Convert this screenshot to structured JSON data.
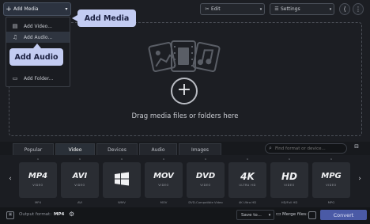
{
  "toolbar": {
    "add_media_label": "Add Media",
    "edit_label": "Edit",
    "settings_label": "Settings"
  },
  "add_menu": {
    "items": [
      {
        "label": "Add Video...",
        "icon": "film-icon"
      },
      {
        "label": "Add Audio...",
        "icon": "music-icon"
      },
      {
        "label": "",
        "icon": ""
      },
      {
        "label": "",
        "icon": ""
      },
      {
        "label": "Add Folder...",
        "icon": "folder-icon"
      }
    ]
  },
  "callouts": {
    "media": "Add Media",
    "audio": "Add Audio"
  },
  "dropzone": {
    "text": "Drag media files or folders here"
  },
  "tabs": [
    "Popular",
    "Video",
    "Devices",
    "Audio",
    "Images"
  ],
  "active_tab": "Video",
  "format_search": {
    "placeholder": "Find format or device..."
  },
  "formats": [
    {
      "logo": "MP4",
      "sub": "VIDEO",
      "label": "MP4"
    },
    {
      "logo": "AVI",
      "sub": "VIDEO",
      "label": "AVI"
    },
    {
      "logo": "",
      "sub": "",
      "label": "WMV"
    },
    {
      "logo": "MOV",
      "sub": "VIDEO",
      "label": "MOV"
    },
    {
      "logo": "DVD",
      "sub": "VIDEO",
      "label": "DVD-Compatible Video"
    },
    {
      "logo": "4K",
      "sub": "ULTRA HD",
      "label": "4K Ultra HD"
    },
    {
      "logo": "HD",
      "sub": "VIDEO",
      "label": "HD/Full HD"
    },
    {
      "logo": "MPG",
      "sub": "VIDEO",
      "label": "MPG"
    }
  ],
  "bottom": {
    "output_format_label": "Output format:",
    "output_format_value": "MP4",
    "save_to_label": "Save to...",
    "merge_files_label": "Merge files:",
    "convert_label": "Convert"
  },
  "colors": {
    "accent": "#4a5aa6",
    "callout": "#c3ccf2",
    "background": "#1c1e23"
  }
}
